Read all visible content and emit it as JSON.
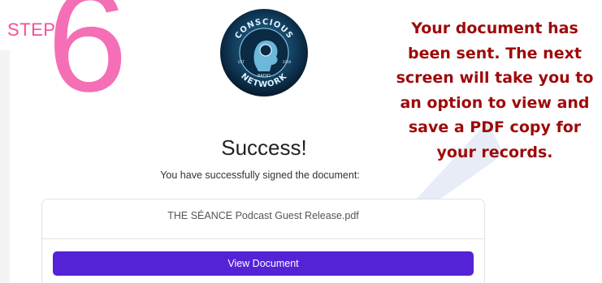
{
  "step": {
    "label": "STEP",
    "number": "6"
  },
  "logo": {
    "top_text": "CONSCIOUS",
    "middle_text": "RADIO",
    "bottom_text": "NETWORK",
    "left_small": "EST",
    "right_small": "2019"
  },
  "success": {
    "title": "Success!",
    "subtitle": "You have successfully signed the document:"
  },
  "document": {
    "file_name": "THE SÉANCE Podcast Guest Release.pdf",
    "view_button_label": "View Document"
  },
  "note": {
    "text": "Your document has been sent. The next screen will take you to an option to view and save a PDF copy for your records."
  },
  "colors": {
    "step_pink": "#f46fb6",
    "button_purple": "#5423d6",
    "note_red": "#9e0a0a"
  }
}
